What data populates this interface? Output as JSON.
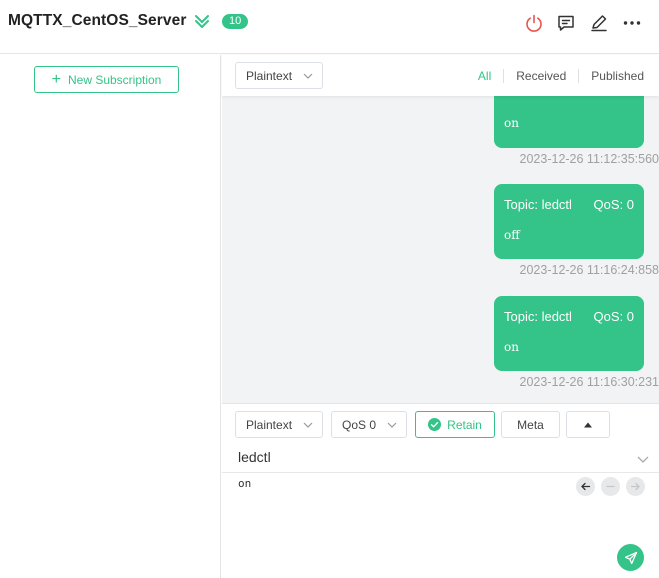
{
  "header": {
    "title": "MQTTX_CentOS_Server",
    "count_badge": "10",
    "icons": [
      "expand-icon",
      "disconnect-icon",
      "message-icon",
      "edit-icon",
      "more-icon"
    ]
  },
  "sidebar": {
    "new_subscription_label": "New Subscription"
  },
  "toolbar": {
    "payload_format": "Plaintext",
    "filters": [
      "All",
      "Received",
      "Published"
    ],
    "active_filter": "All"
  },
  "messages": [
    {
      "topic_label": "",
      "qos_label": "",
      "payload": "on",
      "time": "2023-12-26 11:12:35:560"
    },
    {
      "topic_label": "Topic: ledctl",
      "qos_label": "QoS: 0",
      "payload": "off",
      "time": "2023-12-26 11:16:24:858"
    },
    {
      "topic_label": "Topic: ledctl",
      "qos_label": "QoS: 0",
      "payload": "on",
      "time": "2023-12-26 11:16:30:231"
    }
  ],
  "publish": {
    "payload_format": "Plaintext",
    "qos": "QoS 0",
    "retain_label": "Retain",
    "meta_label": "Meta",
    "topic": "ledctl",
    "payload": "on"
  },
  "colors": {
    "accent": "#34c388",
    "disconnect": "#e8554e",
    "muted_text": "#a0a0a0",
    "message_area_bg": "#f2f3f4"
  }
}
